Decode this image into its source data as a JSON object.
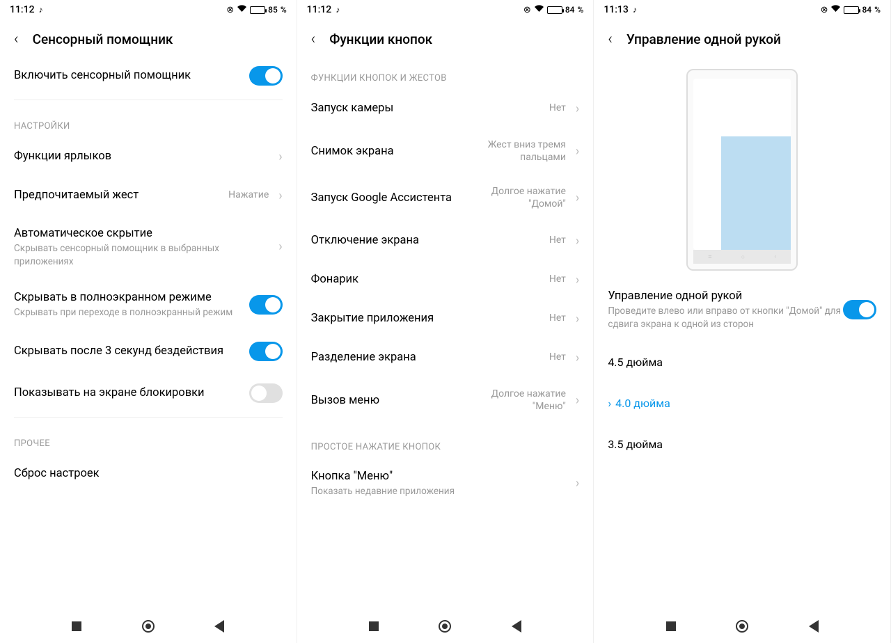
{
  "screens": [
    {
      "status": {
        "time": "11:12",
        "battery": "85",
        "battery_pct_width": "85%"
      },
      "title": "Сенсорный помощник",
      "enable": {
        "label": "Включить сенсорный помощник",
        "on": true
      },
      "sections": [
        {
          "header": "НАСТРОЙКИ",
          "items": [
            {
              "title": "Функции ярлыков",
              "value": "",
              "chevron": true
            },
            {
              "title": "Предпочитаемый жест",
              "value": "Нажатие",
              "chevron": true
            },
            {
              "title": "Автоматическое скрытие",
              "sub": "Скрывать сенсорный помощник в выбранных приложениях",
              "chevron": true
            },
            {
              "title": "Скрывать в полноэкранном режиме",
              "sub": "Скрывать при переходе в полноэкранный режим",
              "toggle": true,
              "on": true
            },
            {
              "title": "Скрывать после 3 секунд бездействия",
              "toggle": true,
              "on": true
            },
            {
              "title": "Показывать на экране блокировки",
              "toggle": true,
              "on": false
            }
          ]
        },
        {
          "header": "ПРОЧЕЕ",
          "items": [
            {
              "title": "Сброс настроек"
            }
          ]
        }
      ]
    },
    {
      "status": {
        "time": "11:12",
        "battery": "84",
        "battery_pct_width": "84%"
      },
      "title": "Функции кнопок",
      "sections": [
        {
          "header": "ФУНКЦИИ КНОПОК И ЖЕСТОВ",
          "items": [
            {
              "title": "Запуск камеры",
              "value": "Нет",
              "chevron": true
            },
            {
              "title": "Снимок экрана",
              "value": "Жест вниз тремя пальцами",
              "chevron": true
            },
            {
              "title": "Запуск Google Ассистента",
              "value": "Долгое нажатие \"Домой\"",
              "chevron": true
            },
            {
              "title": "Отключение экрана",
              "value": "Нет",
              "chevron": true
            },
            {
              "title": "Фонарик",
              "value": "Нет",
              "chevron": true
            },
            {
              "title": "Закрытие приложения",
              "value": "Нет",
              "chevron": true
            },
            {
              "title": "Разделение экрана",
              "value": "Нет",
              "chevron": true
            },
            {
              "title": "Вызов меню",
              "value": "Долгое нажатие \"Меню\"",
              "chevron": true
            }
          ]
        },
        {
          "header": "ПРОСТОЕ НАЖАТИЕ КНОПОК",
          "items": [
            {
              "title": "Кнопка \"Меню\"",
              "sub": "Показать недавние приложения",
              "chevron": true
            }
          ]
        }
      ]
    },
    {
      "status": {
        "time": "11:13",
        "battery": "84",
        "battery_pct_width": "84%"
      },
      "title": "Управление одной рукой",
      "onehand": {
        "title": "Управление одной рукой",
        "sub": "Проведите влево или вправо от кнопки \"Домой\" для сдвига экрана к одной из сторон",
        "on": true
      },
      "sizes": [
        {
          "label": "4.5 дюйма",
          "selected": false
        },
        {
          "label": "4.0 дюйма",
          "selected": true
        },
        {
          "label": "3.5 дюйма",
          "selected": false
        }
      ]
    }
  ],
  "percent_symbol": "%"
}
